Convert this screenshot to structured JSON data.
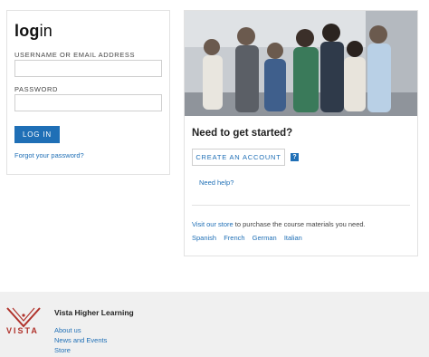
{
  "login": {
    "title_bold": "log",
    "title_light": "in",
    "username_label": "USERNAME OR EMAIL ADDRESS",
    "username_value": "",
    "password_label": "PASSWORD",
    "password_value": "",
    "login_button": "LOG IN",
    "forgot_link": "Forgot your password?"
  },
  "start": {
    "title": "Need to get started?",
    "create_button": "CREATE AN ACCOUNT",
    "help_icon_glyph": "?",
    "need_help": "Need help?",
    "visit_prefix": "Visit our store",
    "visit_suffix": " to purchase the course materials you need.",
    "languages": [
      "Spanish",
      "French",
      "German",
      "Italian"
    ]
  },
  "footer": {
    "brand_word": "VISTA",
    "title": "Vista Higher Learning",
    "links": [
      "About us",
      "News and Events",
      "Store"
    ]
  },
  "colors": {
    "accent": "#1f6fb6",
    "brand_red": "#b0322b",
    "footer_bg": "#f0f0f0"
  }
}
